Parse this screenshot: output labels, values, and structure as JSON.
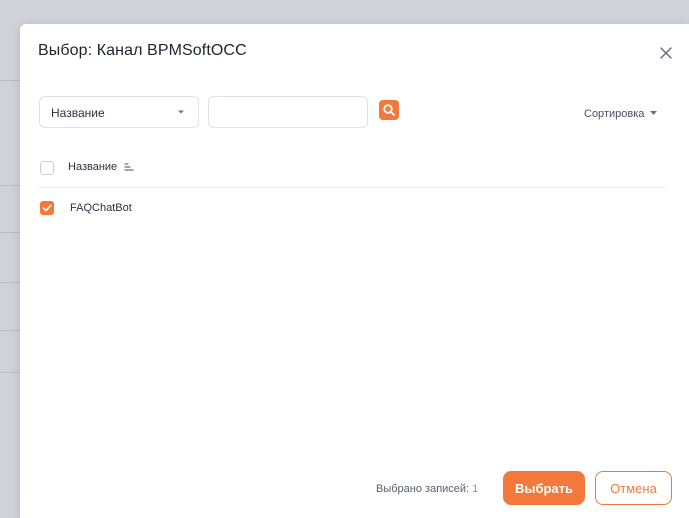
{
  "dialog": {
    "title": "Выбор: Канал BPMSoftOCC",
    "close_icon": "close-icon"
  },
  "filter": {
    "column_value": "Название",
    "search_value": "",
    "search_icon": "search-icon",
    "sort_label": "Сортировка"
  },
  "table": {
    "header": {
      "label": "Название",
      "checked": false,
      "sort_icon": "sort-ascending-icon"
    },
    "rows": [
      {
        "name": "FAQChatBot",
        "checked": true
      }
    ]
  },
  "footer": {
    "selected_label": "Выбрано записей:",
    "selected_count": "1",
    "select_button": "Выбрать",
    "cancel_button": "Отмена"
  },
  "colors": {
    "accent": "#f2793b",
    "text": "#2d3140",
    "border": "#dfe2e8"
  }
}
